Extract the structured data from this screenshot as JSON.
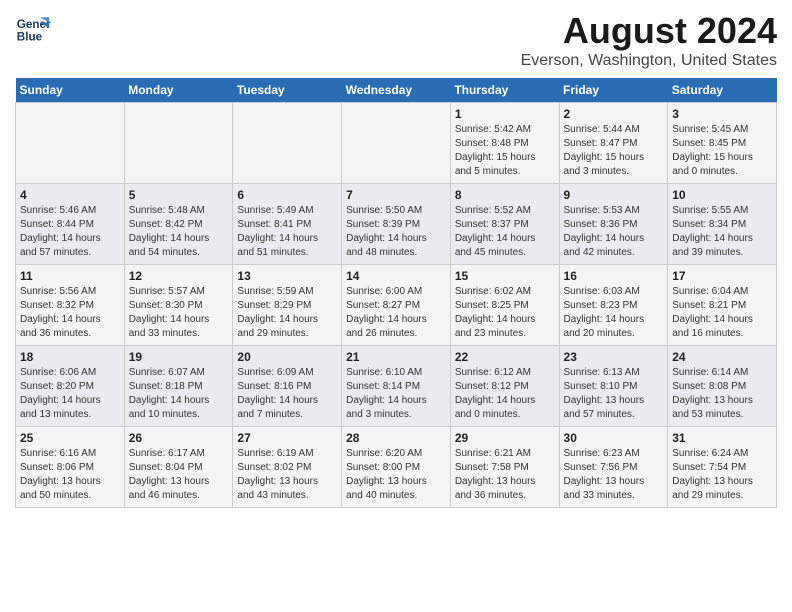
{
  "header": {
    "logo_line1": "General",
    "logo_line2": "Blue",
    "title": "August 2024",
    "subtitle": "Everson, Washington, United States"
  },
  "days_of_week": [
    "Sunday",
    "Monday",
    "Tuesday",
    "Wednesday",
    "Thursday",
    "Friday",
    "Saturday"
  ],
  "weeks": [
    [
      {
        "day": "",
        "info": ""
      },
      {
        "day": "",
        "info": ""
      },
      {
        "day": "",
        "info": ""
      },
      {
        "day": "",
        "info": ""
      },
      {
        "day": "1",
        "info": "Sunrise: 5:42 AM\nSunset: 8:48 PM\nDaylight: 15 hours\nand 5 minutes."
      },
      {
        "day": "2",
        "info": "Sunrise: 5:44 AM\nSunset: 8:47 PM\nDaylight: 15 hours\nand 3 minutes."
      },
      {
        "day": "3",
        "info": "Sunrise: 5:45 AM\nSunset: 8:45 PM\nDaylight: 15 hours\nand 0 minutes."
      }
    ],
    [
      {
        "day": "4",
        "info": "Sunrise: 5:46 AM\nSunset: 8:44 PM\nDaylight: 14 hours\nand 57 minutes."
      },
      {
        "day": "5",
        "info": "Sunrise: 5:48 AM\nSunset: 8:42 PM\nDaylight: 14 hours\nand 54 minutes."
      },
      {
        "day": "6",
        "info": "Sunrise: 5:49 AM\nSunset: 8:41 PM\nDaylight: 14 hours\nand 51 minutes."
      },
      {
        "day": "7",
        "info": "Sunrise: 5:50 AM\nSunset: 8:39 PM\nDaylight: 14 hours\nand 48 minutes."
      },
      {
        "day": "8",
        "info": "Sunrise: 5:52 AM\nSunset: 8:37 PM\nDaylight: 14 hours\nand 45 minutes."
      },
      {
        "day": "9",
        "info": "Sunrise: 5:53 AM\nSunset: 8:36 PM\nDaylight: 14 hours\nand 42 minutes."
      },
      {
        "day": "10",
        "info": "Sunrise: 5:55 AM\nSunset: 8:34 PM\nDaylight: 14 hours\nand 39 minutes."
      }
    ],
    [
      {
        "day": "11",
        "info": "Sunrise: 5:56 AM\nSunset: 8:32 PM\nDaylight: 14 hours\nand 36 minutes."
      },
      {
        "day": "12",
        "info": "Sunrise: 5:57 AM\nSunset: 8:30 PM\nDaylight: 14 hours\nand 33 minutes."
      },
      {
        "day": "13",
        "info": "Sunrise: 5:59 AM\nSunset: 8:29 PM\nDaylight: 14 hours\nand 29 minutes."
      },
      {
        "day": "14",
        "info": "Sunrise: 6:00 AM\nSunset: 8:27 PM\nDaylight: 14 hours\nand 26 minutes."
      },
      {
        "day": "15",
        "info": "Sunrise: 6:02 AM\nSunset: 8:25 PM\nDaylight: 14 hours\nand 23 minutes."
      },
      {
        "day": "16",
        "info": "Sunrise: 6:03 AM\nSunset: 8:23 PM\nDaylight: 14 hours\nand 20 minutes."
      },
      {
        "day": "17",
        "info": "Sunrise: 6:04 AM\nSunset: 8:21 PM\nDaylight: 14 hours\nand 16 minutes."
      }
    ],
    [
      {
        "day": "18",
        "info": "Sunrise: 6:06 AM\nSunset: 8:20 PM\nDaylight: 14 hours\nand 13 minutes."
      },
      {
        "day": "19",
        "info": "Sunrise: 6:07 AM\nSunset: 8:18 PM\nDaylight: 14 hours\nand 10 minutes."
      },
      {
        "day": "20",
        "info": "Sunrise: 6:09 AM\nSunset: 8:16 PM\nDaylight: 14 hours\nand 7 minutes."
      },
      {
        "day": "21",
        "info": "Sunrise: 6:10 AM\nSunset: 8:14 PM\nDaylight: 14 hours\nand 3 minutes."
      },
      {
        "day": "22",
        "info": "Sunrise: 6:12 AM\nSunset: 8:12 PM\nDaylight: 14 hours\nand 0 minutes."
      },
      {
        "day": "23",
        "info": "Sunrise: 6:13 AM\nSunset: 8:10 PM\nDaylight: 13 hours\nand 57 minutes."
      },
      {
        "day": "24",
        "info": "Sunrise: 6:14 AM\nSunset: 8:08 PM\nDaylight: 13 hours\nand 53 minutes."
      }
    ],
    [
      {
        "day": "25",
        "info": "Sunrise: 6:16 AM\nSunset: 8:06 PM\nDaylight: 13 hours\nand 50 minutes."
      },
      {
        "day": "26",
        "info": "Sunrise: 6:17 AM\nSunset: 8:04 PM\nDaylight: 13 hours\nand 46 minutes."
      },
      {
        "day": "27",
        "info": "Sunrise: 6:19 AM\nSunset: 8:02 PM\nDaylight: 13 hours\nand 43 minutes."
      },
      {
        "day": "28",
        "info": "Sunrise: 6:20 AM\nSunset: 8:00 PM\nDaylight: 13 hours\nand 40 minutes."
      },
      {
        "day": "29",
        "info": "Sunrise: 6:21 AM\nSunset: 7:58 PM\nDaylight: 13 hours\nand 36 minutes."
      },
      {
        "day": "30",
        "info": "Sunrise: 6:23 AM\nSunset: 7:56 PM\nDaylight: 13 hours\nand 33 minutes."
      },
      {
        "day": "31",
        "info": "Sunrise: 6:24 AM\nSunset: 7:54 PM\nDaylight: 13 hours\nand 29 minutes."
      }
    ]
  ]
}
